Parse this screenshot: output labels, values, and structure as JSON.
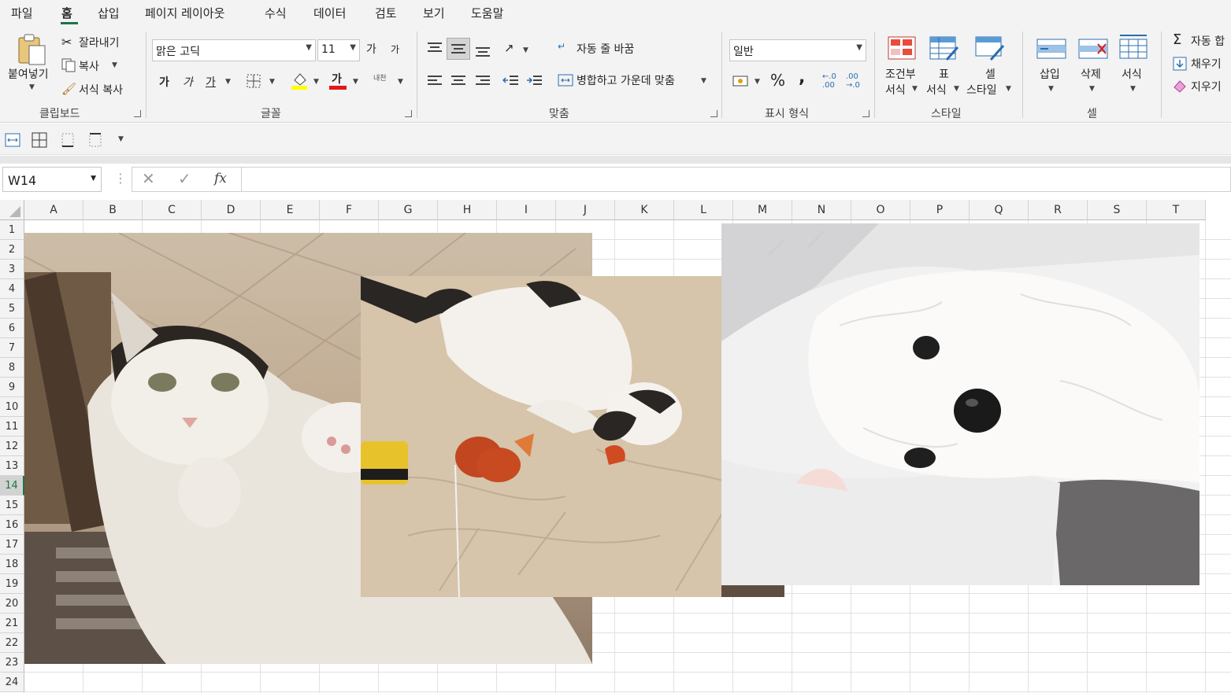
{
  "menu": [
    "파일",
    "홈",
    "삽입",
    "페이지 레이아웃",
    "수식",
    "데이터",
    "검토",
    "보기",
    "도움말"
  ],
  "clipboard": {
    "paste": "붙여넣기",
    "cut": "잘라내기",
    "copy": "복사",
    "format_painter": "서식 복사",
    "group": "클립보드"
  },
  "font": {
    "name": "맑은 고딕",
    "size": "11",
    "grow": "가",
    "shrink": "가",
    "bold": "가",
    "italic": "가",
    "underline": "가",
    "color_letter": "가",
    "phonetic": "내천",
    "group": "글꼴"
  },
  "alignment": {
    "wrap": "자동 줄 바꿈",
    "merge": "병합하고 가운데 맞춤",
    "group": "맞춤"
  },
  "number": {
    "format": "일반",
    "percent": "%",
    "comma": ",",
    "group": "표시 형식"
  },
  "styles": {
    "conditional_line1": "조건부",
    "conditional_line2": "서식",
    "table_line1": "표",
    "table_line2": "서식",
    "cell_line1": "셀",
    "cell_line2": "스타일",
    "group": "스타일"
  },
  "cells": {
    "insert": "삽입",
    "delete": "삭제",
    "format": "서식",
    "group": "셀"
  },
  "editing": {
    "autosum": "자동 합",
    "fill": "채우기",
    "clear": "지우기"
  },
  "namebox": "W14",
  "fx": "fx",
  "columns": [
    "A",
    "B",
    "C",
    "D",
    "E",
    "F",
    "G",
    "H",
    "I",
    "J",
    "K",
    "L",
    "M",
    "N",
    "O",
    "P",
    "Q",
    "R",
    "S",
    "T"
  ],
  "rows": [
    "1",
    "2",
    "3",
    "4",
    "5",
    "6",
    "7",
    "8",
    "9",
    "10",
    "11",
    "12",
    "13",
    "14",
    "15",
    "16",
    "17",
    "18",
    "19",
    "20",
    "21",
    "22",
    "23",
    "24"
  ],
  "selected_row": "14",
  "colors": {
    "accent": "#217346",
    "ribbon_bg": "#f3f3f3",
    "grid_line": "#e1e1e1"
  },
  "images": [
    "cat-lying-on-back-photo",
    "cat-playing-with-toys-photo",
    "white-dog-lying-photo"
  ]
}
